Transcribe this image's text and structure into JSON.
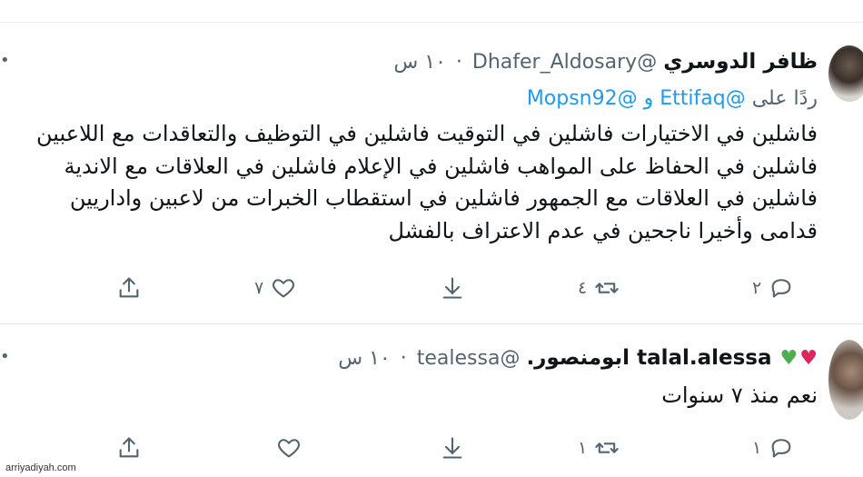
{
  "tweets": [
    {
      "name": "ظافر الدوسري",
      "handle": "@Dhafer_Aldosary",
      "time": "١٠ س",
      "reply_prefix": "ردًا على",
      "reply_user1": "@Ettifaq",
      "reply_and": "و",
      "reply_user2": "@Mopsn92",
      "text": "فاشلين في الاختيارات فاشلين في التوقيت فاشلين في التوظيف والتعاقدات مع اللاعبين فاشلين في الحفاظ على المواهب فاشلين في الإعلام فاشلين في العلاقات مع الاندية فاشلين في العلاقات مع الجمهور فاشلين في استقطاب الخبرات من لاعبين واداريين قدامى وأخيرا ناجحين في عدم الاعتراف بالفشل",
      "reply_count": "٢",
      "retweet_count": "٤",
      "like_count": "٧"
    },
    {
      "name": "talal.alessa ابومنصور.",
      "handle": "@tealessa",
      "time": "١٠ س",
      "text": "نعم منذ ٧ سنوات",
      "reply_count": "١",
      "retweet_count": "١",
      "like_count": ""
    }
  ],
  "icons": {
    "more": "more-dots-icon",
    "reply": "reply-bubble-icon",
    "retweet": "retweet-icon",
    "download": "download-arrow-icon",
    "like": "heart-outline-icon",
    "share": "share-upload-icon",
    "heart_red": "red-heart-emoji",
    "heart_green": "green-heart-emoji"
  },
  "colors": {
    "link": "#1d9bf0",
    "secondary": "#536471",
    "heart_red": "#e0245e",
    "heart_green": "#4caf50"
  },
  "watermark": "arriyadiyah.com"
}
